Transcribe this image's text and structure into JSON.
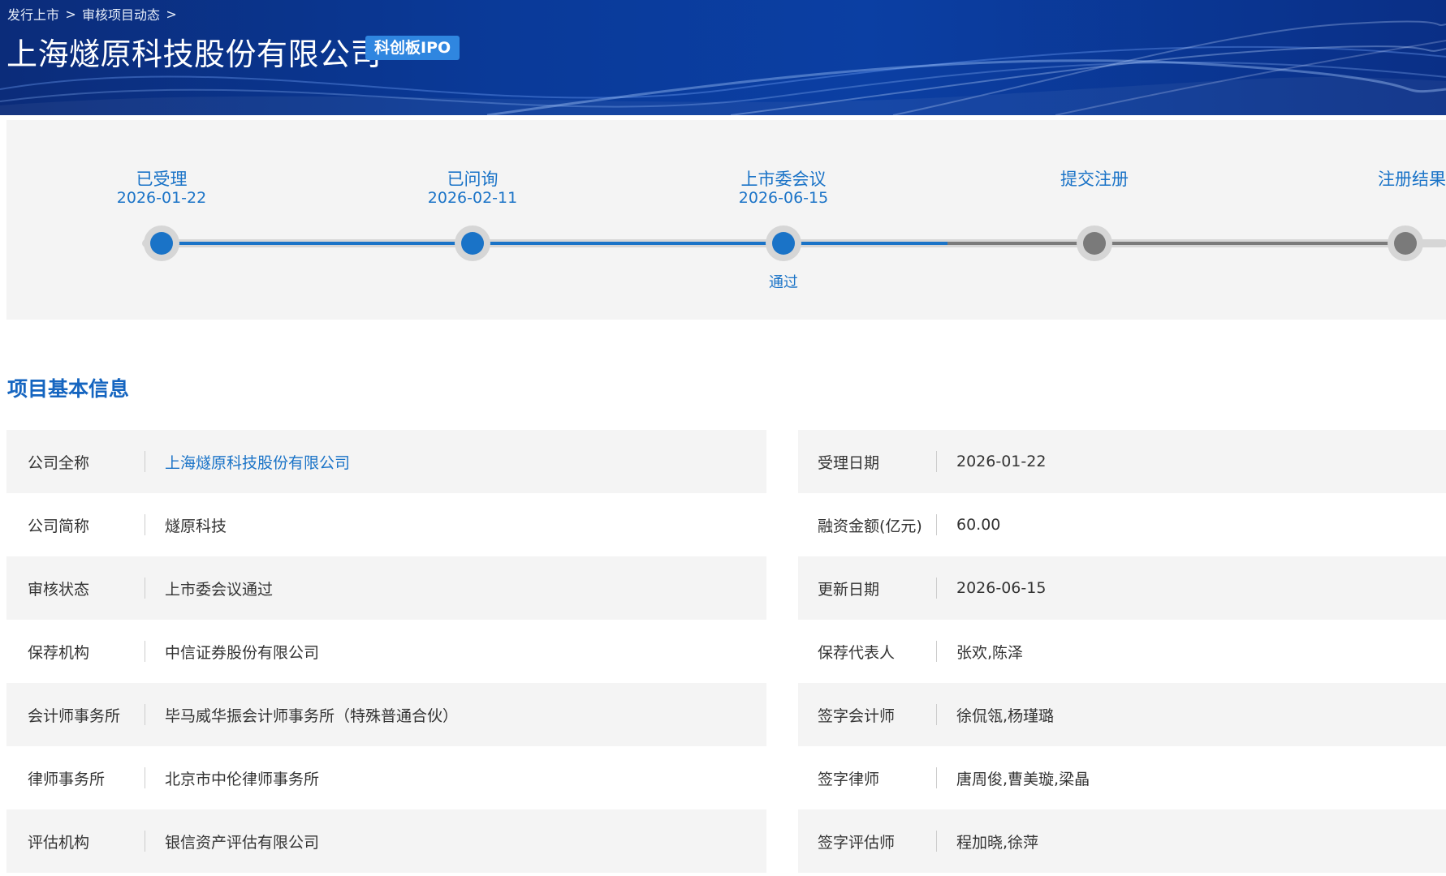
{
  "breadcrumb": {
    "items": [
      "发行上市",
      "审核项目动态"
    ],
    "separator": ">"
  },
  "header": {
    "company_name": "上海燧原科技股份有限公司",
    "board_badge": "科创板IPO"
  },
  "progress": {
    "steps": [
      {
        "label": "已受理",
        "date": "2026-01-22",
        "status": "done",
        "result": ""
      },
      {
        "label": "已问询",
        "date": "2026-02-11",
        "status": "done",
        "result": ""
      },
      {
        "label": "上市委会议",
        "date": "2026-06-15",
        "status": "done",
        "result": "通过"
      },
      {
        "label": "提交注册",
        "date": "",
        "status": "todo",
        "result": ""
      },
      {
        "label": "注册结果",
        "date": "",
        "status": "todo",
        "result": ""
      }
    ]
  },
  "section": {
    "title": "项目基本信息"
  },
  "info_left": [
    {
      "label": "公司全称",
      "value": "上海燧原科技股份有限公司",
      "link": true
    },
    {
      "label": "公司简称",
      "value": "燧原科技"
    },
    {
      "label": "审核状态",
      "value": "上市委会议通过"
    },
    {
      "label": "保荐机构",
      "value": "中信证券股份有限公司"
    },
    {
      "label": "会计师事务所",
      "value": "毕马威华振会计师事务所（特殊普通合伙）"
    },
    {
      "label": "律师事务所",
      "value": "北京市中伦律师事务所"
    },
    {
      "label": "评估机构",
      "value": "银信资产评估有限公司"
    }
  ],
  "info_right": [
    {
      "label": "受理日期",
      "value": "2026-01-22"
    },
    {
      "label": "融资金额(亿元)",
      "value": "60.00"
    },
    {
      "label": "更新日期",
      "value": "2026-06-15"
    },
    {
      "label": "保荐代表人",
      "value": "张欢,陈泽"
    },
    {
      "label": "签字会计师",
      "value": "徐侃瓴,杨瑾璐"
    },
    {
      "label": "签字律师",
      "value": "唐周俊,曹美璇,梁晶"
    },
    {
      "label": "签字评估师",
      "value": "程加晓,徐萍"
    }
  ],
  "colors": {
    "accent": "#1a73c7",
    "banner": "#0b3fa3",
    "pending": "#7a7a7a",
    "row_shade": "#f4f4f4"
  }
}
